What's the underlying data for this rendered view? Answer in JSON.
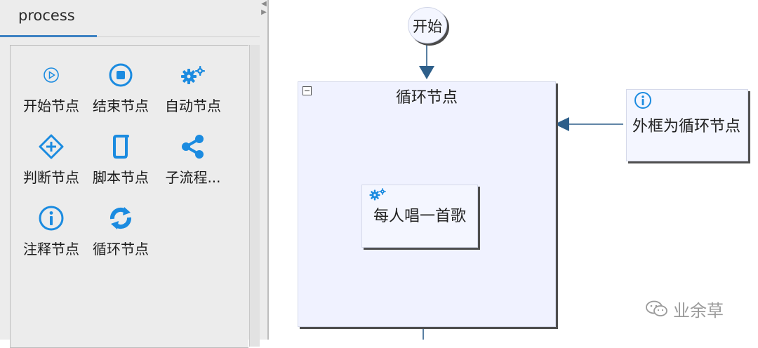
{
  "palette": {
    "tab_title": "process",
    "items": [
      {
        "label": "开始节点",
        "icon": "start-node-icon"
      },
      {
        "label": "结束节点",
        "icon": "end-node-icon"
      },
      {
        "label": "自动节点",
        "icon": "gears-icon"
      },
      {
        "label": "判断节点",
        "icon": "decision-icon"
      },
      {
        "label": "脚本节点",
        "icon": "script-icon"
      },
      {
        "label": "子流程...",
        "icon": "share-icon"
      },
      {
        "label": "注释节点",
        "icon": "info-icon"
      },
      {
        "label": "循环节点",
        "icon": "loop-icon"
      }
    ]
  },
  "canvas": {
    "start_label": "开始",
    "loop_title": "循环节点",
    "task_title": "每人唱一首歌",
    "note_text": "外框为循环节点"
  },
  "watermark": {
    "text": "业余草"
  },
  "colors": {
    "accent": "#3d82c3",
    "icon_blue": "#1b8be0",
    "node_fill": "#f0f2ff",
    "connector": "#2e5f8a"
  }
}
